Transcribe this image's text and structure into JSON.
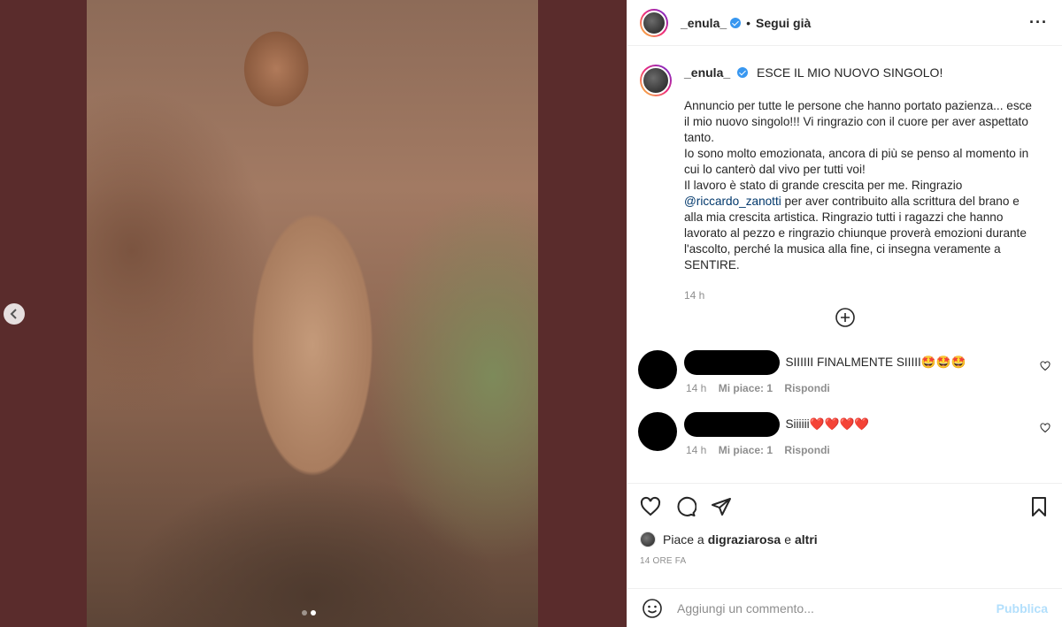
{
  "post": {
    "username": "_enula_",
    "follow_separator": "•",
    "follow_label": "Segui già",
    "more_icon": "more-horizontal-icon"
  },
  "caption": {
    "username": "_enula_",
    "headline": "ESCE IL MIO NUOVO SINGOLO!",
    "text_before_mention": "Annuncio per tutte le persone che hanno portato pazienza... esce il mio nuovo singolo!!! Vi ringrazio con il cuore per aver aspettato tanto.\nIo sono molto emozionata, ancora di più se penso al momento in cui lo canterò dal vivo per tutti voi!\nIl lavoro è stato di grande crescita per me. Ringrazio ",
    "mention": "@riccardo_zanotti",
    "text_after_mention": " per aver contribuito alla scrittura del brano e alla mia crescita artistica. Ringrazio tutti i ragazzi che hanno lavorato al pezzo e ringrazio chiunque proverà emozioni durante l'ascolto, perché la musica alla fine, ci insegna veramente a SENTIRE.",
    "time": "14 h"
  },
  "comments": [
    {
      "text": "SIIIIII FINALMENTE SIIIII🤩🤩🤩",
      "time": "14 h",
      "likes": "Mi piace: 1",
      "reply": "Rispondi"
    },
    {
      "text": "Siiiiii❤️❤️❤️❤️",
      "time": "14 h",
      "likes": "Mi piace: 1",
      "reply": "Rispondi"
    }
  ],
  "likes": {
    "prefix": "Piace a ",
    "user": "digraziarosa",
    "connector": " e ",
    "others": "altri"
  },
  "posted_ago": "14 ORE FA",
  "add_comment": {
    "placeholder": "Aggiungi un commento...",
    "publish_label": "Pubblica"
  },
  "carousel": {
    "count": 2,
    "active_index": 1
  }
}
